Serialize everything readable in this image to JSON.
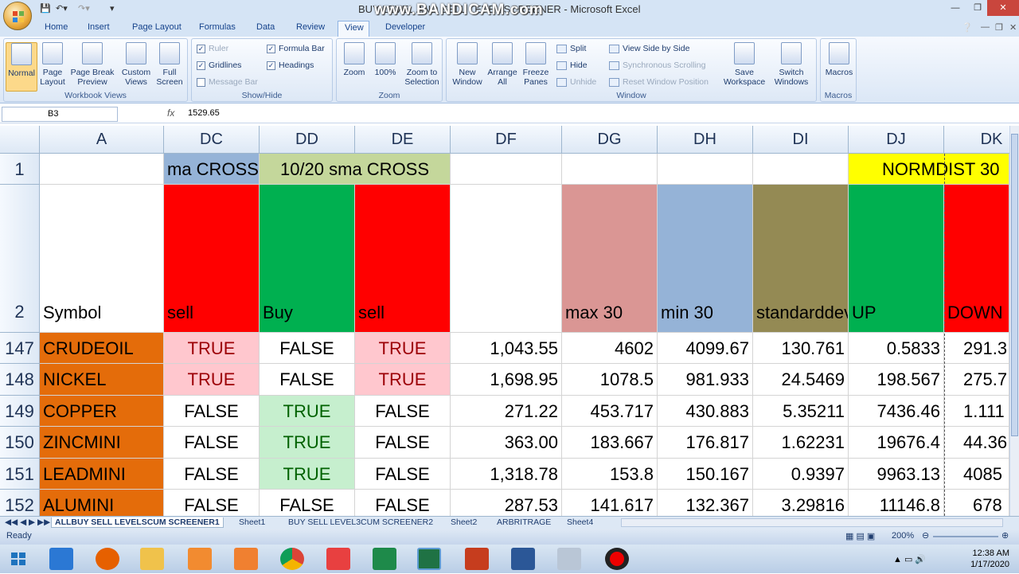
{
  "window": {
    "title": "BUY LEVEL AND SELL LEVEL SCREENER - Microsoft Excel",
    "watermark": "www.BANDICAM.com"
  },
  "tabs": [
    "Home",
    "Insert",
    "Page Layout",
    "Formulas",
    "Data",
    "Review",
    "View",
    "Developer"
  ],
  "active_tab": "View",
  "ribbon": {
    "workbook_views": {
      "label": "Workbook Views",
      "normal": "Normal",
      "page_layout": "Page Layout",
      "page_break": "Page Break Preview",
      "custom_views": "Custom Views",
      "full_screen": "Full Screen"
    },
    "show_hide": {
      "label": "Show/Hide",
      "ruler": "Ruler",
      "gridlines": "Gridlines",
      "message_bar": "Message Bar",
      "formula_bar": "Formula Bar",
      "headings": "Headings"
    },
    "zoom": {
      "label": "Zoom",
      "zoom": "Zoom",
      "hundred": "100%",
      "selection": "Zoom to Selection"
    },
    "window": {
      "label": "Window",
      "new_window": "New Window",
      "arrange_all": "Arrange All",
      "freeze_panes": "Freeze Panes",
      "split": "Split",
      "hide": "Hide",
      "unhide": "Unhide",
      "side_by_side": "View Side by Side",
      "sync_scroll": "Synchronous Scrolling",
      "reset_pos": "Reset Window Position",
      "save_workspace": "Save Workspace",
      "switch_windows": "Switch Windows"
    },
    "macros": {
      "label": "Macros",
      "macros": "Macros"
    }
  },
  "formula_bar": {
    "name_box": "B3",
    "fx": "fx",
    "formula": "1529.65"
  },
  "grid": {
    "columns": [
      "A",
      "DC",
      "DD",
      "DE",
      "DF",
      "DG",
      "DH",
      "DI",
      "DJ",
      "DK"
    ],
    "row1": {
      "num": "1",
      "dc": "ma CROSS",
      "ddde": "10/20 sma CROSS",
      "djdk": "NORMDIST 30"
    },
    "row2": {
      "num": "2",
      "a": "Symbol",
      "dc": "sell",
      "dd": "Buy",
      "de": "sell",
      "dg": "max 30",
      "dh": "min 30",
      "di": "standarddev",
      "dj": "UP",
      "dk": "DOWN"
    },
    "rows": [
      {
        "num": "147",
        "a": "CRUDEOIL",
        "dc": "TRUE",
        "dd": "FALSE",
        "de": "TRUE",
        "df": "1,043.55",
        "dg": "4602",
        "dh": "4099.67",
        "di": "130.761",
        "dj": "0.5833",
        "dk": "291.3"
      },
      {
        "num": "148",
        "a": "NICKEL",
        "dc": "TRUE",
        "dd": "FALSE",
        "de": "TRUE",
        "df": "1,698.95",
        "dg": "1078.5",
        "dh": "981.933",
        "di": "24.5469",
        "dj": "198.567",
        "dk": "275.7"
      },
      {
        "num": "149",
        "a": "COPPER",
        "dc": "FALSE",
        "dd": "TRUE",
        "de": "FALSE",
        "df": "271.22",
        "dg": "453.717",
        "dh": "430.883",
        "di": "5.35211",
        "dj": "7436.46",
        "dk": "1.111"
      },
      {
        "num": "150",
        "a": "ZINCMINI",
        "dc": "FALSE",
        "dd": "TRUE",
        "de": "FALSE",
        "df": "363.00",
        "dg": "183.667",
        "dh": "176.817",
        "di": "1.62231",
        "dj": "19676.4",
        "dk": "44.36"
      },
      {
        "num": "151",
        "a": "LEADMINI",
        "dc": "FALSE",
        "dd": "TRUE",
        "de": "FALSE",
        "df": "1,318.78",
        "dg": "153.8",
        "dh": "150.167",
        "di": "0.9397",
        "dj": "9963.13",
        "dk": "4085"
      },
      {
        "num": "152",
        "a": "ALUMINI",
        "dc": "FALSE",
        "dd": "FALSE",
        "de": "FALSE",
        "df": "287.53",
        "dg": "141.617",
        "dh": "132.367",
        "di": "3.29816",
        "dj": "11146.8",
        "dk": "678"
      }
    ]
  },
  "sheets": [
    "ALLBUY SELL LEVELSCUM SCREENER1",
    "Sheet1",
    "BUY SELL LEVEL3CUM SCREENER2",
    "Sheet2",
    "ARBRITRAGE",
    "Sheet4"
  ],
  "status": {
    "ready": "Ready",
    "zoom": "200%"
  },
  "clock": {
    "time": "12:38 AM",
    "date": "1/17/2020"
  },
  "colors": {
    "orange": "#e46c0a",
    "red": "#ff0000",
    "green": "#00b050",
    "pink": "#ffc7ce",
    "lightgreen": "#c6efce",
    "lightblue": "#95b3d7",
    "olive": "#948a54",
    "salmon": "#da9694",
    "yellow": "#ffff00",
    "sage": "#c4d79b"
  }
}
